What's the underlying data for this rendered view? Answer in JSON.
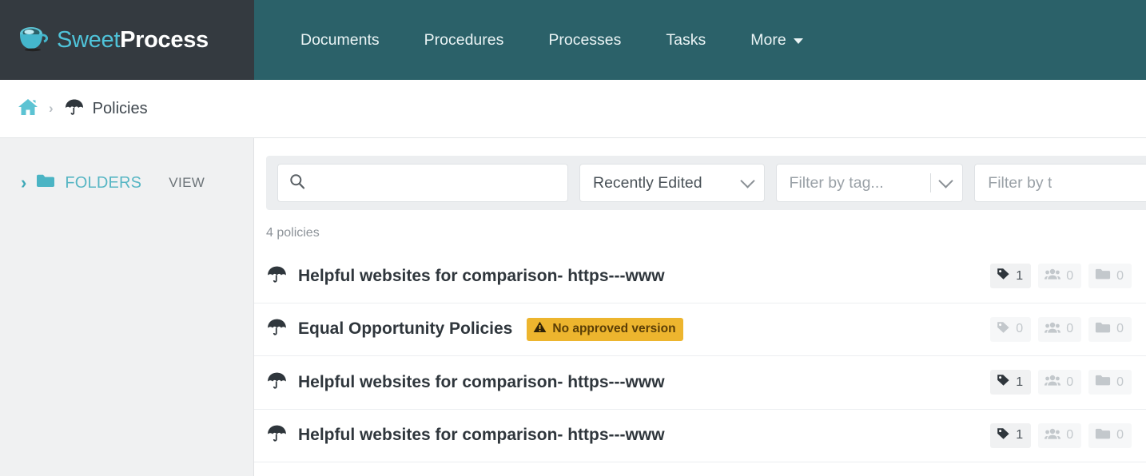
{
  "brand": {
    "icon": "coffee-cup-icon",
    "name_first": "Sweet",
    "name_second": "Process"
  },
  "nav": {
    "items": [
      {
        "label": "Documents"
      },
      {
        "label": "Procedures"
      },
      {
        "label": "Processes"
      },
      {
        "label": "Tasks"
      },
      {
        "label": "More",
        "has_caret": true
      }
    ]
  },
  "breadcrumb": {
    "home_icon": "home-icon",
    "separator": "›",
    "current_icon": "umbrella-icon",
    "current_label": "Policies"
  },
  "sidebar": {
    "chevron": "›",
    "folders_icon": "folder-icon",
    "folders_label": "FOLDERS",
    "view_label": "VIEW"
  },
  "toolbar": {
    "search": {
      "icon": "search-icon",
      "value": "",
      "placeholder": ""
    },
    "sort": {
      "value": "Recently Edited",
      "icon": "chevron-down-icon"
    },
    "tag_filter": {
      "placeholder": "Filter by tag...",
      "icon": "chevron-down-icon"
    },
    "type_filter": {
      "placeholder": "Filter by t",
      "icon": "chevron-down-icon"
    }
  },
  "list": {
    "count_label": "4 policies",
    "rows": [
      {
        "icon": "umbrella-icon",
        "title": "Helpful websites for comparison- https---www",
        "badge": null,
        "meta": [
          {
            "icon": "tag-icon",
            "count": "1",
            "muted": false
          },
          {
            "icon": "people-icon",
            "count": "0",
            "muted": true
          },
          {
            "icon": "folder-icon",
            "count": "0",
            "muted": true
          }
        ]
      },
      {
        "icon": "umbrella-icon",
        "title": "Equal Opportunity Policies",
        "badge": {
          "icon": "warning-icon",
          "text": "No approved version"
        },
        "meta": [
          {
            "icon": "tag-icon",
            "count": "0",
            "muted": true
          },
          {
            "icon": "people-icon",
            "count": "0",
            "muted": true
          },
          {
            "icon": "folder-icon",
            "count": "0",
            "muted": true
          }
        ]
      },
      {
        "icon": "umbrella-icon",
        "title": "Helpful websites for comparison- https---www",
        "badge": null,
        "meta": [
          {
            "icon": "tag-icon",
            "count": "1",
            "muted": false
          },
          {
            "icon": "people-icon",
            "count": "0",
            "muted": true
          },
          {
            "icon": "folder-icon",
            "count": "0",
            "muted": true
          }
        ]
      },
      {
        "icon": "umbrella-icon",
        "title": "Helpful websites for comparison- https---www",
        "badge": null,
        "meta": [
          {
            "icon": "tag-icon",
            "count": "1",
            "muted": false
          },
          {
            "icon": "people-icon",
            "count": "0",
            "muted": true
          },
          {
            "icon": "folder-icon",
            "count": "0",
            "muted": true
          }
        ]
      }
    ]
  },
  "colors": {
    "brand_dark": "#343a40",
    "nav_teal": "#2b6169",
    "accent_teal": "#57b6c4",
    "warning_amber": "#edb52e",
    "sidebar_gray": "#f0f1f2"
  }
}
